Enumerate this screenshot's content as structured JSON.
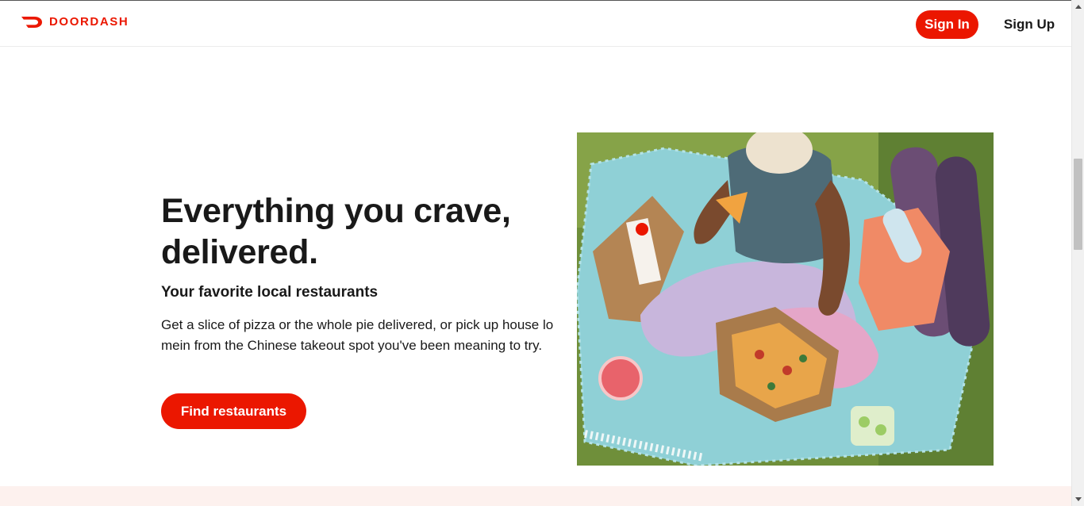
{
  "header": {
    "logo_text": "DOORDASH",
    "sign_in_label": "Sign In",
    "sign_up_label": "Sign Up"
  },
  "hero": {
    "title_line1": "Everything you crave,",
    "title_line2": "delivered.",
    "subtitle": "Your favorite local restaurants",
    "description": "Get a slice of pizza or the whole pie delivered, or pick up house lo mein from the Chinese takeout spot you've been meaning to try.",
    "cta_label": "Find restaurants",
    "image_alt": "Person eating pizza on a picnic blanket"
  },
  "colors": {
    "brand_red": "#eb1700",
    "text_dark": "#191919",
    "band_pink": "#fdf1ee"
  },
  "icons": {
    "logo": "doordash-logo-icon",
    "scroll_up": "scroll-up-arrow-icon",
    "scroll_down": "scroll-down-arrow-icon"
  }
}
